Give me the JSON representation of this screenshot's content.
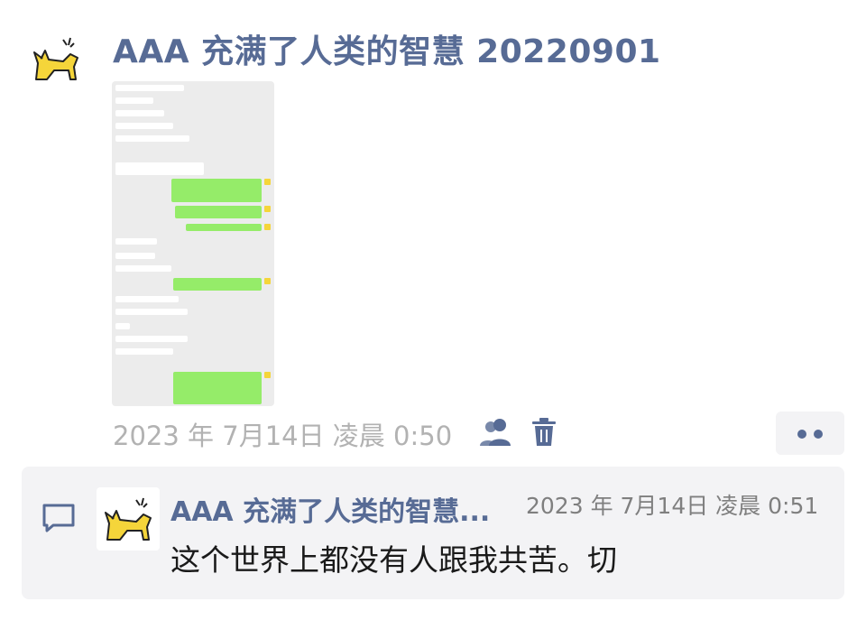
{
  "post": {
    "author_name": "AAA 充满了人类的智慧 20220901",
    "timestamp": "2023 年 7月14日 凌晨 0:50",
    "attachment_icon": "chat-screenshot-image",
    "avatar_icon": "yellow-cat-icon"
  },
  "actions": {
    "visibility_icon": "friends-icon",
    "delete_icon": "trash-icon",
    "more_icon": "more-dots-icon"
  },
  "comment": {
    "author_name": "AAA 充满了人类的智慧...",
    "timestamp": "2023 年 7月14日 凌晨 0:51",
    "text": "这个世界上都没有人跟我共苦。切",
    "icon": "comment-bubble-icon"
  },
  "colors": {
    "link_name": "#576b95",
    "meta_gray": "#b2b2b2",
    "panel_bg": "#f3f3f5",
    "wechat_green_bubble": "#95ec69",
    "avatar_yellow": "#f5d53a"
  }
}
